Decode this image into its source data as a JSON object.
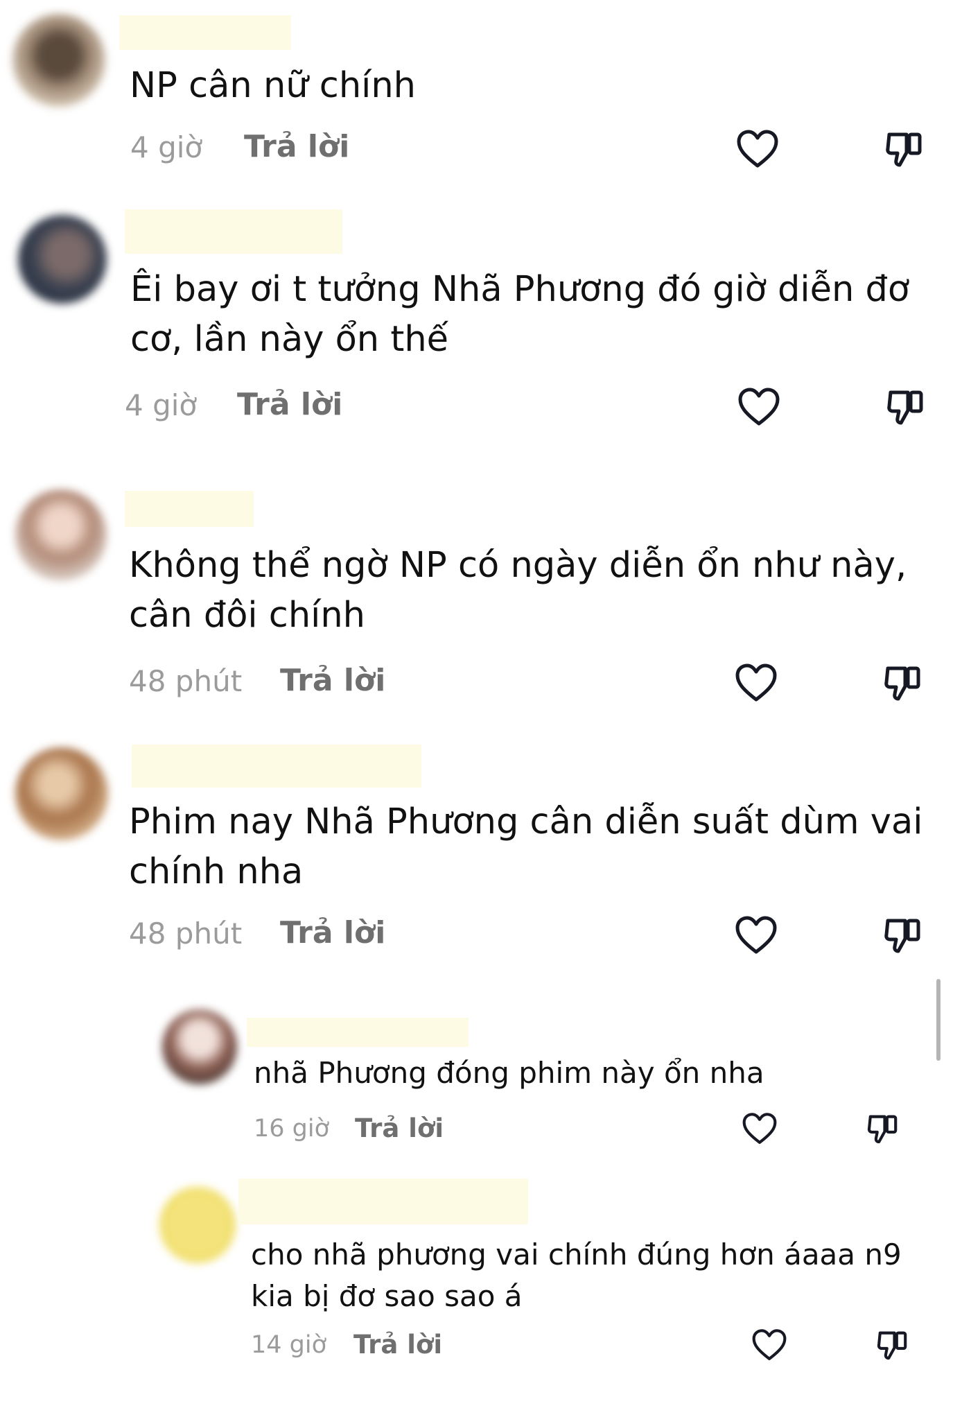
{
  "comments": [
    {
      "text_lines": [
        "NP cân nữ chính"
      ],
      "time": "4 giờ",
      "reply_label": "Trả lời",
      "avatar_icon": "avatar-image",
      "like_icon": "heart-icon",
      "dislike_icon": "thumbs-down-icon"
    },
    {
      "text_lines": [
        "Êi bay ơi t tưởng Nhã Phương đó giờ diễn đơ",
        "cơ, lần này ổn thế"
      ],
      "time": "4 giờ",
      "reply_label": "Trả lời",
      "avatar_icon": "avatar-image",
      "like_icon": "heart-icon",
      "dislike_icon": "thumbs-down-icon"
    },
    {
      "text_lines": [
        "Không thể ngờ NP có ngày diễn ổn như này,",
        "cân đôi chính"
      ],
      "time": "48 phút",
      "reply_label": "Trả lời",
      "avatar_icon": "avatar-image",
      "like_icon": "heart-icon",
      "dislike_icon": "thumbs-down-icon"
    },
    {
      "text_lines": [
        "Phim nay Nhã Phương cân diễn suất dùm vai",
        "chính nha"
      ],
      "time": "48 phút",
      "reply_label": "Trả lời",
      "avatar_icon": "avatar-image",
      "like_icon": "heart-icon",
      "dislike_icon": "thumbs-down-icon"
    }
  ],
  "replies": [
    {
      "text_lines": [
        "nhã Phương đóng phim này ổn nha"
      ],
      "time": "16 giờ",
      "reply_label": "Trả lời",
      "avatar_icon": "avatar-image",
      "like_icon": "heart-icon",
      "dislike_icon": "thumbs-down-icon"
    },
    {
      "text_lines": [
        "cho nhã phương vai chính đúng hơn áaaa n9",
        "kia bị đơ sao sao á"
      ],
      "time": "14 giờ",
      "reply_label": "Trả lời",
      "avatar_icon": "avatar-image",
      "like_icon": "heart-icon",
      "dislike_icon": "thumbs-down-icon"
    }
  ],
  "colors": {
    "text": "#111111",
    "time": "#9b9b9b",
    "reply": "#6f6f6f",
    "icon": "#161823",
    "name_mask": "#fdfbe3"
  }
}
